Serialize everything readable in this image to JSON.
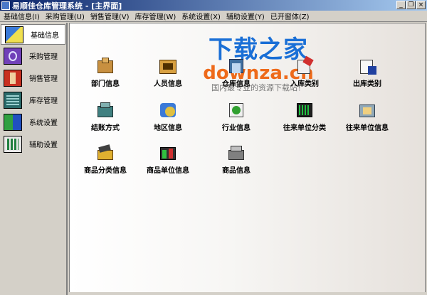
{
  "window": {
    "title": "易顺佳仓库管理系统 - [主界面]",
    "controls": [
      "_",
      "❐",
      "×"
    ]
  },
  "menu": [
    {
      "label": "基础信息(I)"
    },
    {
      "label": "采购管理(U)"
    },
    {
      "label": "销售管理(V)"
    },
    {
      "label": "库存管理(W)"
    },
    {
      "label": "系统设置(X)"
    },
    {
      "label": "辅助设置(Y)"
    },
    {
      "label": "已开窗体(Z)"
    }
  ],
  "sidebar": {
    "items": [
      {
        "label": "基础信息",
        "icon": "basic-info-icon",
        "active": true
      },
      {
        "label": "采购管理",
        "icon": "purchase-icon",
        "active": false
      },
      {
        "label": "销售管理",
        "icon": "sales-icon",
        "active": false
      },
      {
        "label": "库存管理",
        "icon": "inventory-icon",
        "active": false
      },
      {
        "label": "系统设置",
        "icon": "system-settings-icon",
        "active": false
      },
      {
        "label": "辅助设置",
        "icon": "aux-settings-icon",
        "active": false
      }
    ]
  },
  "tiles": [
    {
      "label": "部门信息",
      "icon": "department-icon"
    },
    {
      "label": "人员信息",
      "icon": "personnel-icon"
    },
    {
      "label": "仓库信息",
      "icon": "warehouse-icon"
    },
    {
      "label": "入库类别",
      "icon": "inbound-type-icon"
    },
    {
      "label": "出库类别",
      "icon": "outbound-type-icon"
    },
    {
      "label": "结账方式",
      "icon": "settlement-icon"
    },
    {
      "label": "地区信息",
      "icon": "region-icon"
    },
    {
      "label": "行业信息",
      "icon": "industry-icon"
    },
    {
      "label": "往来单位分类",
      "icon": "partner-category-icon"
    },
    {
      "label": "往来单位信息",
      "icon": "partner-info-icon"
    },
    {
      "label": "商品分类信息",
      "icon": "product-category-icon"
    },
    {
      "label": "商品单位信息",
      "icon": "product-unit-icon"
    },
    {
      "label": "商品信息",
      "icon": "product-info-icon"
    }
  ],
  "watermark": {
    "line1": "下载之家",
    "line2": "downza.cn",
    "line3": "国内最专业的资源下载站！"
  },
  "colors": {
    "titlebar_start": "#0a246a",
    "titlebar_end": "#a6caf0",
    "chrome": "#d4d0c8",
    "watermark_blue": "#1a6fd6",
    "watermark_orange": "#ee6a1a"
  }
}
